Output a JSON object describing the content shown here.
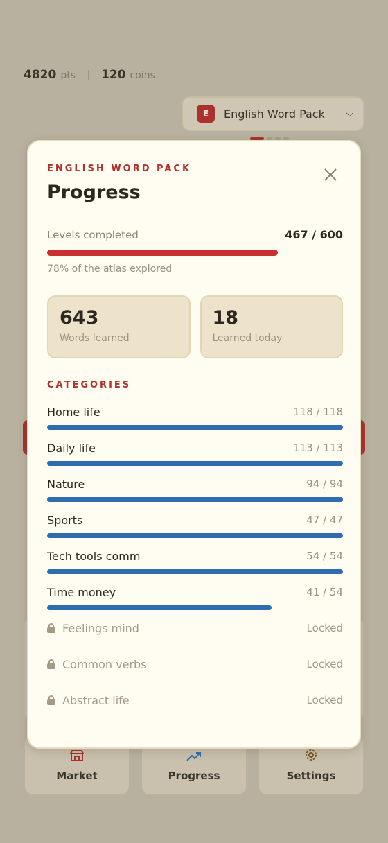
{
  "header": {
    "points_value": "4820",
    "points_unit": "pts",
    "coins_value": "120",
    "coins_unit": "coins"
  },
  "pack_selector": {
    "badge": "E",
    "label": "English Word Pack"
  },
  "bottom_nav": [
    {
      "label": "Market",
      "icon": "store-icon"
    },
    {
      "label": "Progress",
      "icon": "trending-up-icon"
    },
    {
      "label": "Settings",
      "icon": "gear-icon"
    }
  ],
  "modal": {
    "eyebrow": "ENGLISH WORD PACK",
    "title": "Progress",
    "levels_label": "Levels completed",
    "levels_value": "467 / 600",
    "levels_progress": 0.78,
    "levels_caption": "78% of the atlas explored",
    "stats": [
      {
        "value": "643",
        "label": "Words learned"
      },
      {
        "value": "18",
        "label": "Learned today"
      }
    ],
    "categories_heading": "CATEGORIES",
    "categories": [
      {
        "name": "Home life",
        "count": "118 / 118",
        "progress": 1.0,
        "locked": false
      },
      {
        "name": "Daily life",
        "count": "113 / 113",
        "progress": 1.0,
        "locked": false
      },
      {
        "name": "Nature",
        "count": "94 / 94",
        "progress": 1.0,
        "locked": false
      },
      {
        "name": "Sports",
        "count": "47 / 47",
        "progress": 1.0,
        "locked": false
      },
      {
        "name": "Tech tools comm",
        "count": "54 / 54",
        "progress": 1.0,
        "locked": false
      },
      {
        "name": "Time money",
        "count": "41 / 54",
        "progress": 0.759,
        "locked": false
      },
      {
        "name": "Feelings mind",
        "count": "Locked",
        "locked": true
      },
      {
        "name": "Common verbs",
        "count": "Locked",
        "locked": true
      },
      {
        "name": "Abstract life",
        "count": "Locked",
        "locked": true
      }
    ]
  },
  "colors": {
    "accent_red": "#c9302f",
    "progress_blue": "#2f6db0",
    "modal_bg": "#fffcf2"
  }
}
